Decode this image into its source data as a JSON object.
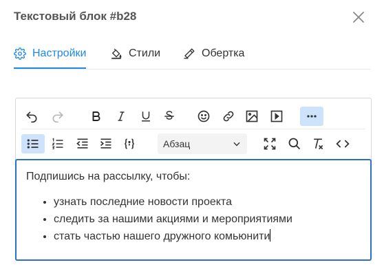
{
  "dialog": {
    "title": "Текстовый блок #b28"
  },
  "tabs": [
    {
      "label": "Настройки",
      "icon": "gear-icon",
      "active": true
    },
    {
      "label": "Стили",
      "icon": "paint-bucket-icon",
      "active": false
    },
    {
      "label": "Обертка",
      "icon": "brush-icon",
      "active": false
    }
  ],
  "toolbar": {
    "format_select": {
      "value": "Абзац"
    },
    "icons": [
      "undo-icon",
      "redo-icon",
      "bold-icon",
      "italic-icon",
      "underline-icon",
      "strikethrough-icon",
      "emoji-icon",
      "link-icon",
      "image-icon",
      "media-icon",
      "more-icon",
      "bullet-list-icon",
      "numbered-list-icon",
      "outdent-icon",
      "indent-icon",
      "code-braces-icon",
      "fullscreen-icon",
      "search-icon",
      "clear-format-icon",
      "source-code-icon"
    ]
  },
  "content": {
    "intro": "Подпишись на рассылку, чтобы:",
    "items": [
      "узнать последние новости проекта",
      "следить за нашими акциями и мероприятиями",
      "стать частью нашего дружного комьюнити"
    ]
  },
  "colors": {
    "accent": "#1e88e5",
    "editor_border": "#2b6fc5",
    "active_button_bg": "#cde3fb"
  }
}
